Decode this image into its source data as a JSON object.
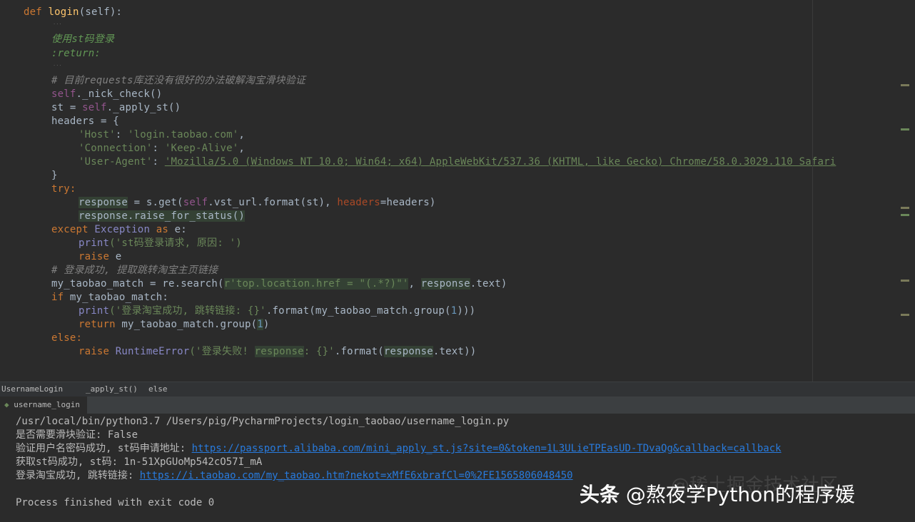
{
  "editor": {
    "def_kw": "def",
    "fn_name": "login",
    "params": "(self):",
    "hint": "...",
    "doc1": "使用st码登录",
    "doc2": ":return:",
    "comment1": "# 目前requests库还没有很好的办法破解淘宝滑块验证",
    "l_nick_self": "self",
    "l_nick_rest": "._nick_check()",
    "l_st_var": "st = ",
    "l_st_self": "self",
    "l_st_rest": "._apply_st()",
    "l_headers": "headers = {",
    "h_host_key": "'Host'",
    "h_host_sep": ": ",
    "h_host_val": "'login.taobao.com'",
    "h_conn_key": "'Connection'",
    "h_conn_val": "'Keep-Alive'",
    "h_ua_key": "'User-Agent'",
    "h_ua_val": "'Mozilla/5.0 (Windows NT 10.0; Win64; x64) AppleWebKit/537.36 (KHTML, like Gecko) Chrome/58.0.3029.110 Safari",
    "close_brace": "}",
    "try_kw": "try:",
    "resp_var": "response",
    "resp_get": " = s.get(",
    "resp_self": "self",
    "resp_url": ".vst_url.format(st), ",
    "resp_param": "headers",
    "resp_eq": "=headers)",
    "raise_for": "response.raise_for_status()",
    "except_kw": "except",
    "except_cls": " Exception",
    "as_kw": " as",
    "except_e": " e:",
    "print_fn": "print",
    "print1_str": "('st码登录请求, 原因: ')",
    "raise_kw": "raise",
    "raise_e": " e",
    "comment2": "# 登录成功, 提取跳转淘宝主页链接",
    "match_var": "my_taobao_match = re.search(",
    "match_str": "r'top.location.href = \"(.*?)\"'",
    "match_rest": ", ",
    "match_resp": "response",
    "match_text": ".text)",
    "if_kw": "if",
    "if_rest": " my_taobao_match:",
    "print2_str": "('登录淘宝成功, 跳转链接: {}'",
    "print2_rest": ".format(my_taobao_match.group(",
    "num1": "1",
    "print2_end": ")))",
    "return_kw": "return",
    "return_rest": " my_taobao_match.group(",
    "return_end": ")",
    "else_kw": "else:",
    "raise2_cls": " RuntimeError",
    "raise2_str": "('登录失败! ",
    "raise2_resp": "response",
    "raise2_str2": ": {}'",
    "raise2_fmt": ".format(",
    "raise2_resp2": "response",
    "raise2_end": ".text))"
  },
  "breadcrumb": {
    "item1": "UsernameLogin",
    "item2": "_apply_st()",
    "item3": "else"
  },
  "run_tab": {
    "label": "username_login"
  },
  "console": {
    "line1": "/usr/local/bin/python3.7 /Users/pig/PycharmProjects/login_taobao/username_login.py",
    "line2": "是否需要滑块验证: False",
    "line3_prefix": "验证用户名密码成功, st码申请地址: ",
    "line3_link": "https://passport.alibaba.com/mini_apply_st.js?site=0&token=1L3ULieTPEasUD-TDvaQg&callback=callback",
    "line4": "获取st码成功, st码: 1n-51XpGUoMp542cO57I_mA",
    "line5_prefix": "登录淘宝成功, 跳转链接: ",
    "line5_link": "https://i.taobao.com/my_taobao.htm?nekot=xMfE6xbrafCl=0%2FE1565806048450",
    "line6": "Process finished with exit code 0"
  },
  "watermark": {
    "ghost": "@稀土掘金技术社区",
    "brand": "头条",
    "handle": " @熬夜学Python的程序媛"
  }
}
